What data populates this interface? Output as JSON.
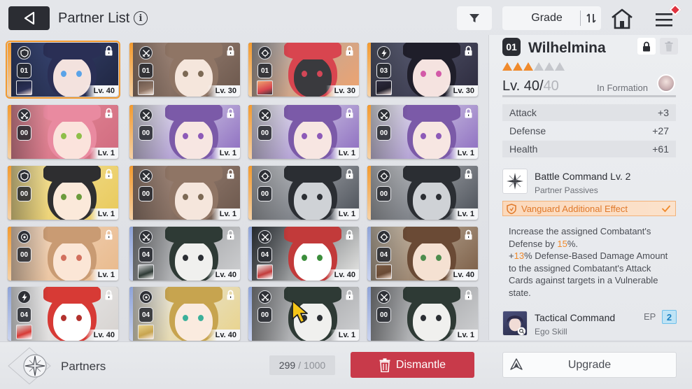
{
  "header": {
    "title": "Partner List",
    "info_icon": "info-icon",
    "filter_icon": "filter-icon",
    "sort_label": "Grade",
    "sort_toggle_icon": "sort-toggle-icon",
    "home_icon": "home-icon",
    "menu_icon": "menu-icon"
  },
  "partners": [
    {
      "rank": "01",
      "level": "Lv. 40",
      "class_icon": "shield-class-icon",
      "avatar": true,
      "selected": true,
      "strip": "#f39a2e"
    },
    {
      "rank": "01",
      "level": "Lv. 30",
      "class_icon": "crossed-swords-class-icon",
      "avatar": true,
      "selected": false,
      "strip": "#f39a2e"
    },
    {
      "rank": "01",
      "level": "Lv. 30",
      "class_icon": "crosshair-class-icon",
      "avatar": true,
      "selected": false,
      "strip": "#f39a2e"
    },
    {
      "rank": "03",
      "level": "Lv. 30",
      "class_icon": "lightning-class-icon",
      "avatar": true,
      "selected": false,
      "strip": "#f39a2e"
    },
    {
      "rank": "00",
      "level": "Lv. 1",
      "class_icon": "crossed-swords-class-icon",
      "avatar": false,
      "selected": false,
      "strip": "#f39a2e"
    },
    {
      "rank": "00",
      "level": "Lv. 1",
      "class_icon": "crossed-swords-class-icon",
      "avatar": false,
      "selected": false,
      "strip": "#f39a2e"
    },
    {
      "rank": "00",
      "level": "Lv. 1",
      "class_icon": "crossed-swords-class-icon",
      "avatar": false,
      "selected": false,
      "strip": "#f39a2e"
    },
    {
      "rank": "00",
      "level": "Lv. 1",
      "class_icon": "crossed-swords-class-icon",
      "avatar": false,
      "selected": false,
      "strip": "#f39a2e"
    },
    {
      "rank": "00",
      "level": "Lv. 1",
      "class_icon": "shield-class-icon",
      "avatar": false,
      "selected": false,
      "strip": "#f39a2e"
    },
    {
      "rank": "00",
      "level": "Lv. 1",
      "class_icon": "crossed-swords-class-icon",
      "avatar": false,
      "selected": false,
      "strip": "#f39a2e"
    },
    {
      "rank": "00",
      "level": "Lv. 1",
      "class_icon": "crosshair-class-icon",
      "avatar": false,
      "selected": false,
      "strip": "#f39a2e"
    },
    {
      "rank": "00",
      "level": "Lv. 1",
      "class_icon": "crosshair-class-icon",
      "avatar": false,
      "selected": false,
      "strip": "#f39a2e"
    },
    {
      "rank": "00",
      "level": "Lv. 1",
      "class_icon": "target-class-icon",
      "avatar": false,
      "selected": false,
      "strip": "#f39a2e"
    },
    {
      "rank": "04",
      "level": "Lv. 40",
      "class_icon": "crossed-swords-class-icon",
      "avatar": true,
      "selected": false,
      "strip": "#8fa4d8"
    },
    {
      "rank": "04",
      "level": "Lv. 40",
      "class_icon": "crossed-swords-class-icon",
      "avatar": true,
      "selected": false,
      "strip": "#8fa4d8"
    },
    {
      "rank": "04",
      "level": "Lv. 40",
      "class_icon": "crosshair-class-icon",
      "avatar": true,
      "selected": false,
      "strip": "#8fa4d8"
    },
    {
      "rank": "04",
      "level": "Lv. 40",
      "class_icon": "lightning-class-icon",
      "avatar": true,
      "selected": false,
      "strip": "#8fa4d8"
    },
    {
      "rank": "04",
      "level": "Lv. 40",
      "class_icon": "target-class-icon",
      "avatar": true,
      "selected": false,
      "strip": "#8fa4d8"
    },
    {
      "rank": "00",
      "level": "Lv. 1",
      "class_icon": "crossed-swords-class-icon",
      "avatar": false,
      "selected": false,
      "strip": "#8fa4d8"
    },
    {
      "rank": "00",
      "level": "Lv. 1",
      "class_icon": "crossed-swords-class-icon",
      "avatar": false,
      "selected": false,
      "strip": "#8fa4d8"
    }
  ],
  "detail": {
    "rank": "01",
    "name": "Wilhelmina",
    "stars_filled": 3,
    "stars_total": 6,
    "level_current": "Lv. 40",
    "level_sep": "/",
    "level_max": "40",
    "formation_label": "In Formation",
    "stats": [
      {
        "label": "Attack",
        "value": "+3"
      },
      {
        "label": "Defense",
        "value": "+27"
      },
      {
        "label": "Health",
        "value": "+61"
      }
    ],
    "passive": {
      "title": "Battle Command Lv. 2",
      "subtitle": "Partner Passives",
      "icon": "compass-star-icon"
    },
    "vanguard_label": "Vanguard Additional Effect",
    "effect": {
      "p1_a": "Increase the assigned Combatant's Defense by ",
      "p1_val": "15",
      "p1_b": "%.",
      "p2_plus": "+",
      "p2_val": "13",
      "p2_b": "% Defense-Based Damage Amount to the assigned Combatant's Attack Cards against targets in a Vulnerable state."
    },
    "ego": {
      "title": "Tactical Command",
      "subtitle": "Ego Skill",
      "ep_label": "EP",
      "ep_value": "2"
    }
  },
  "footer": {
    "partners_label": "Partners",
    "count_current": "299",
    "count_sep": "/",
    "count_max": "1000",
    "dismantle_label": "Dismantle",
    "upgrade_label": "Upgrade"
  },
  "colors": {
    "accent_orange": "#f08a2c",
    "dismantle_red": "#c83a4a",
    "dark": "#2b2d33"
  }
}
